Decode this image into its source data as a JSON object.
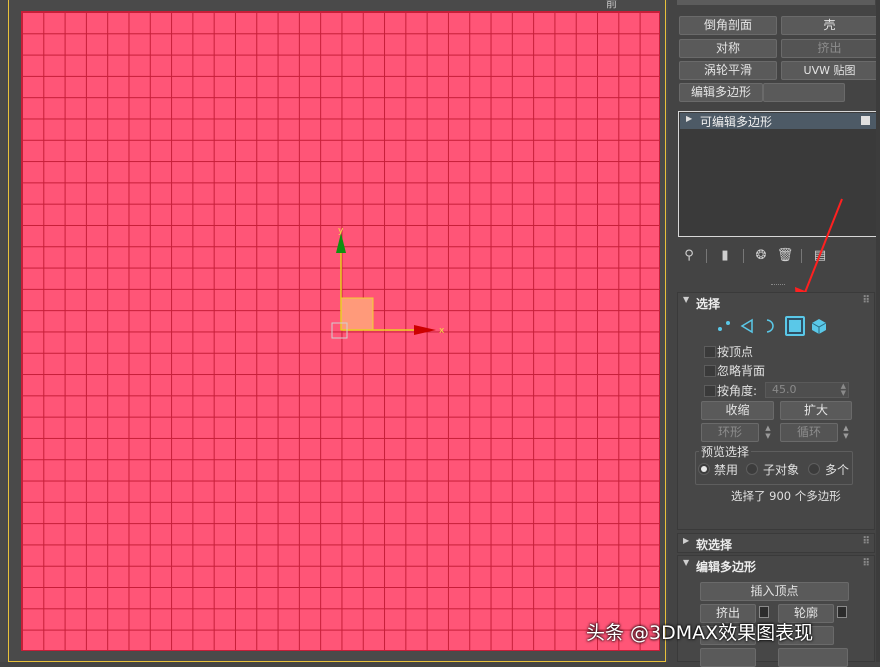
{
  "viewport": {
    "label": "前"
  },
  "modifier_buttons": [
    {
      "label": "倒角剖面"
    },
    {
      "label": "壳"
    },
    {
      "label": "对称"
    },
    {
      "label": "挤出"
    },
    {
      "label": "涡轮平滑"
    },
    {
      "label": "UVW 贴图"
    },
    {
      "label": "编辑多边形"
    }
  ],
  "stack": {
    "item": "可编辑多边形"
  },
  "selection": {
    "title": "选择",
    "by_vertex": "按顶点",
    "ignore_backfacing": "忽略背面",
    "by_angle": "按角度:",
    "angle_value": "45.0",
    "shrink": "收缩",
    "grow": "扩大",
    "ring": "环形",
    "loop": "循环",
    "preview_title": "预览选择",
    "preview_off": "禁用",
    "preview_subobj": "子对象",
    "preview_multi": "多个",
    "status": "选择了 900 个多边形"
  },
  "soft_selection": {
    "title": "软选择"
  },
  "edit_poly": {
    "title": "编辑多边形",
    "insert_vertex": "插入顶点",
    "extrude": "挤出",
    "outline": "轮廓"
  },
  "watermark": "头条 @3DMAX效果图表现",
  "colors": {
    "mesh": "#ff5577",
    "grid_line": "#c61e38",
    "gizmo_x": "#dd0000",
    "gizmo_y": "#00aa00",
    "accent": "#5ac8e8",
    "arrow": "#ff2020"
  }
}
